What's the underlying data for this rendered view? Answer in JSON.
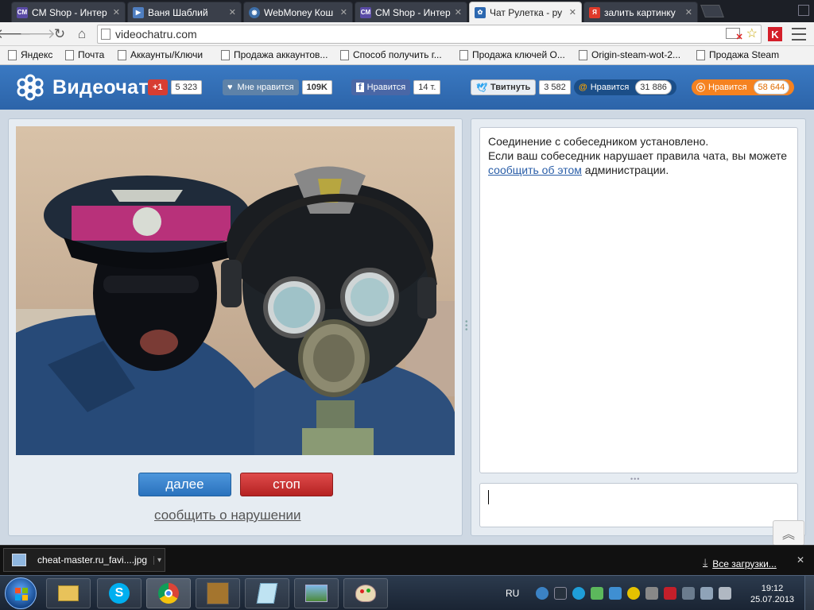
{
  "browser": {
    "tabs": [
      {
        "title": "CM Shop - Интер",
        "favicon_text": "CM",
        "favicon_color": "#5a4ba6",
        "active": false
      },
      {
        "title": "Ваня Шаблий",
        "favicon_text": "",
        "favicon_color": "#4f7ec0",
        "active": false
      },
      {
        "title": "WebMoney Кош",
        "favicon_text": "",
        "favicon_color": "#3d6ea8",
        "active": false
      },
      {
        "title": "CM Shop - Интер",
        "favicon_text": "CM",
        "favicon_color": "#5a4ba6",
        "active": false
      },
      {
        "title": "Чат Рулетка - ру",
        "favicon_text": "",
        "favicon_color": "#2d68b0",
        "active": true
      },
      {
        "title": "залить картинку",
        "favicon_text": "Я",
        "favicon_color": "#e03a2a",
        "active": false
      }
    ],
    "url": "videochatru.com",
    "bookmarks": [
      "Яндекс",
      "Почта",
      "Аккаунты/Ключи",
      "Продажа аккаунтов...",
      "Способ получить г...",
      "Продажа ключей О...",
      "Origin-steam-wot-2...",
      "Продажа Steam"
    ]
  },
  "site": {
    "logo_text": "Видеочат",
    "social": {
      "gplus_label": "+1",
      "gplus_count": "5 323",
      "like_label": "Мне нравится",
      "like_count": "109K",
      "fb_label": "Нравится",
      "fb_count": "14 т.",
      "tw_label": "Твитнуть",
      "tw_count": "3 582",
      "mail_label": "Нравится",
      "mail_count": "31 886",
      "ok_label": "Нравится",
      "ok_count": "58 644"
    },
    "buttons": {
      "next": "далее",
      "stop": "стоп",
      "report": "сообщить о нарушении"
    },
    "chat": {
      "line1": "Соединение с собеседником установлено.",
      "line2": "Если ваш собеседник нарушает правила чата, вы можете",
      "link": "сообщить об этом",
      "line3": "администрации."
    }
  },
  "downloads": {
    "file": "cheat-master.ru_favi....jpg",
    "all": "Все загрузки..."
  },
  "taskbar": {
    "lang": "RU",
    "time": "19:12",
    "date": "25.07.2013"
  },
  "colors": {
    "header_blue": "#2f6cb3",
    "next_blue": "#2a72bd",
    "stop_red": "#c12a2a"
  }
}
